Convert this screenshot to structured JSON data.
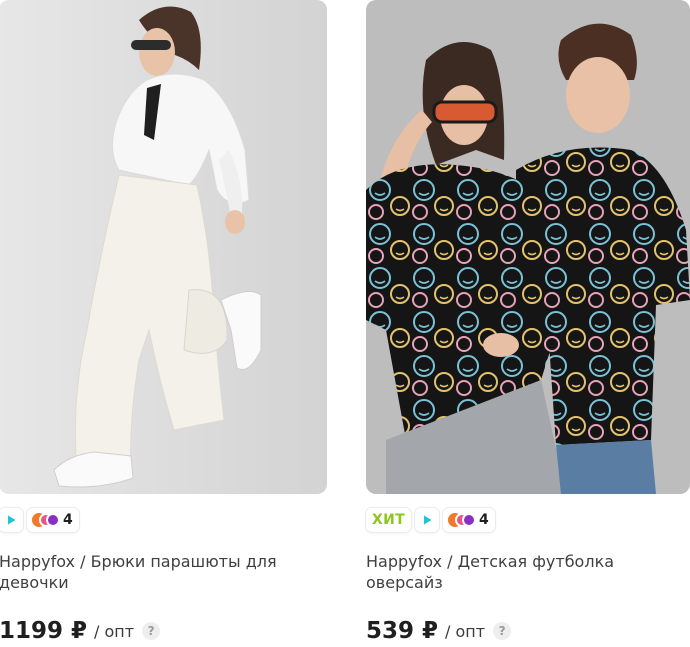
{
  "products": [
    {
      "brand": "Happyfox",
      "title": "Happyfox / Брюки парашюты для девочки",
      "badges": {
        "hit": "",
        "colors_count": "4"
      },
      "price": "1199 ₽",
      "unit": "/ опт",
      "help": "?"
    },
    {
      "brand": "Happyfox",
      "title": "Happyfox / Детская футболка оверсайз",
      "badges": {
        "hit": "ХИТ",
        "colors_count": "4"
      },
      "price": "539 ₽",
      "unit": "/ опт",
      "help": "?"
    }
  ],
  "colors": {
    "hit_green": "#8cc71b",
    "play_teal": "#1cc6d8",
    "swatch_orange": "#f07a2a",
    "swatch_pink": "#e8538c",
    "swatch_purple": "#8a2fc2"
  }
}
